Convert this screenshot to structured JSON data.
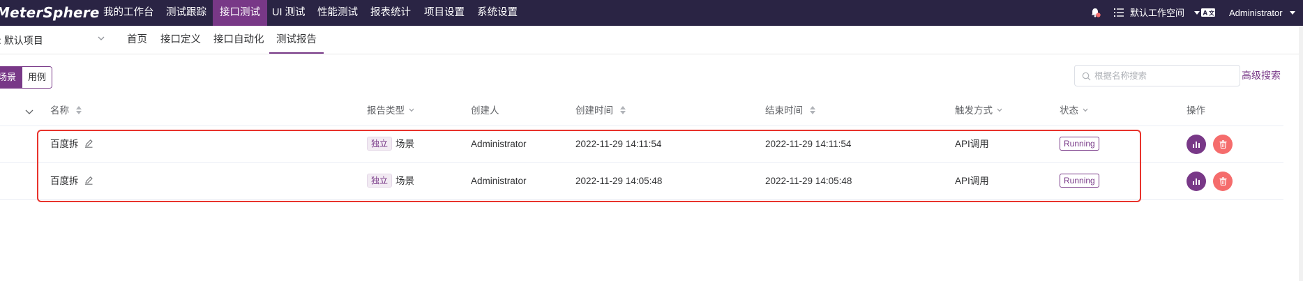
{
  "app": {
    "logo": "MeterSphere"
  },
  "topnav": {
    "items": [
      {
        "label": "我的工作台",
        "active": false
      },
      {
        "label": "测试跟踪",
        "active": false
      },
      {
        "label": "接口测试",
        "active": true
      },
      {
        "label": "UI 测试",
        "active": false
      },
      {
        "label": "性能测试",
        "active": false
      },
      {
        "label": "报表统计",
        "active": false
      },
      {
        "label": "项目设置",
        "active": false
      },
      {
        "label": "系统设置",
        "active": false
      }
    ],
    "workspace": "默认工作空间",
    "user": "Administrator",
    "icons": {
      "bell": "bell-icon",
      "list": "task-list-icon",
      "language": "language-icon"
    }
  },
  "subnav": {
    "project": ": 默认项目",
    "items": [
      {
        "label": "首页",
        "active": false
      },
      {
        "label": "接口定义",
        "active": false
      },
      {
        "label": "接口自动化",
        "active": false
      },
      {
        "label": "测试报告",
        "active": true
      }
    ]
  },
  "toolbar": {
    "segments": [
      {
        "label": "场景",
        "active": true
      },
      {
        "label": "用例",
        "active": false
      }
    ],
    "search_placeholder": "根据名称搜索",
    "advanced_search": "高级搜索"
  },
  "table": {
    "columns": {
      "name": "名称",
      "report_type": "报告类型",
      "creator": "创建人",
      "create_time": "创建时间",
      "end_time": "结束时间",
      "trigger": "触发方式",
      "status": "状态",
      "actions": "操作"
    },
    "rows": [
      {
        "name": "百度拆",
        "type_tag": "独立",
        "type": "场景",
        "creator": "Administrator",
        "create_time": "2022-11-29 14:11:54",
        "end_time": "2022-11-29 14:11:54",
        "trigger": "API调用",
        "status": "Running"
      },
      {
        "name": "百度拆",
        "type_tag": "独立",
        "type": "场景",
        "creator": "Administrator",
        "create_time": "2022-11-29 14:05:48",
        "end_time": "2022-11-29 14:05:48",
        "trigger": "API调用",
        "status": "Running"
      }
    ]
  },
  "colors": {
    "primary": "#783887",
    "topbar": "#2a2444",
    "danger": "#f56c6c",
    "highlight": "#e8332c"
  }
}
